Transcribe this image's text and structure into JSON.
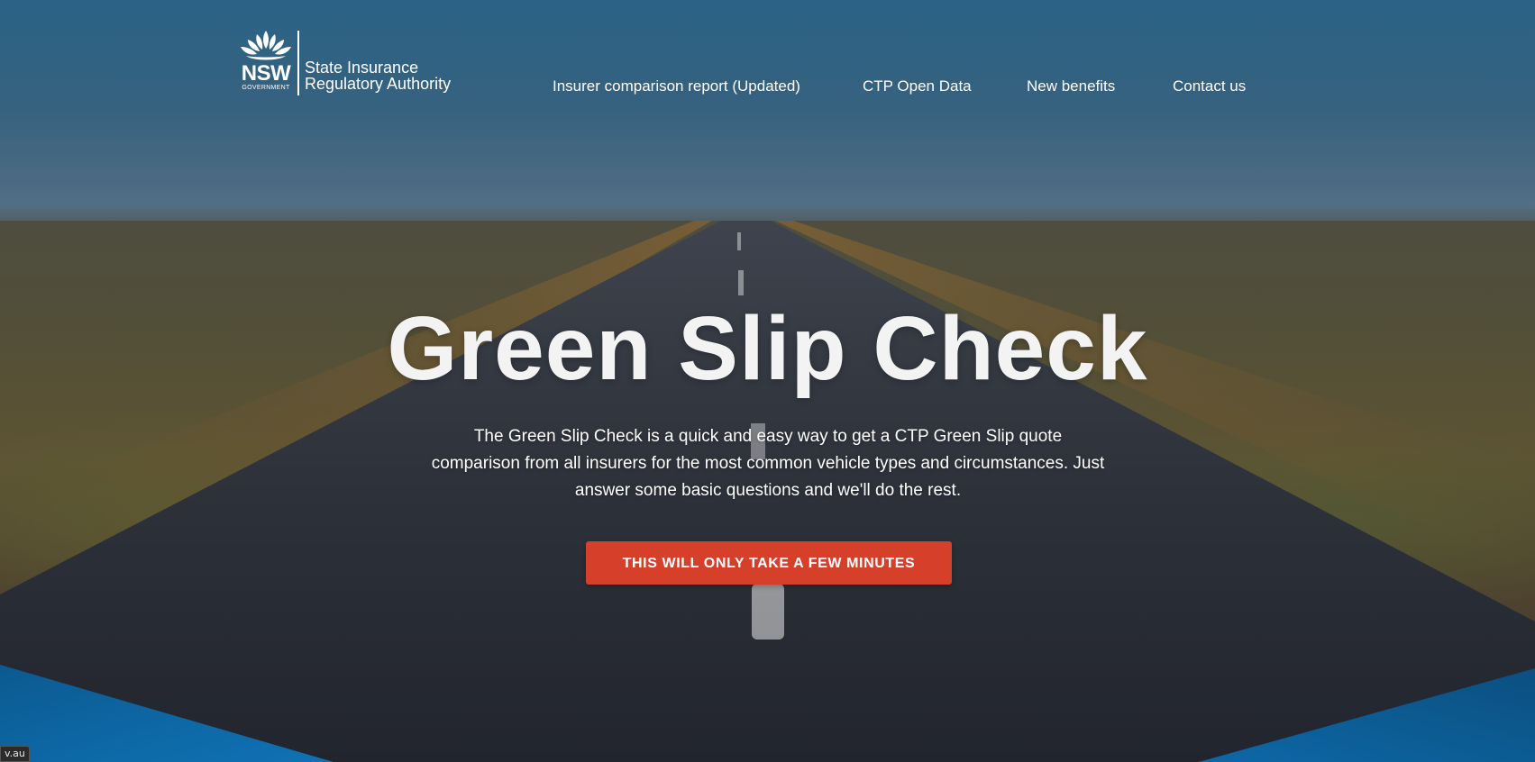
{
  "header": {
    "logo": {
      "mark_text": "NSW",
      "mark_subtext": "GOVERNMENT",
      "agency_line1": "State Insurance",
      "agency_line2": "Regulatory Authority"
    },
    "nav": [
      {
        "label": "Insurer comparison report (Updated)"
      },
      {
        "label": "CTP Open Data"
      },
      {
        "label": "New benefits"
      },
      {
        "label": "Contact us"
      }
    ]
  },
  "hero": {
    "title": "Green Slip Check",
    "description": "The Green Slip Check is a quick and easy way to get a CTP Green Slip quote comparison from all insurers for the most common vehicle types and circumstances. Just answer some basic questions and we'll do the rest.",
    "cta_label": "THIS WILL ONLY TAKE A FEW MINUTES"
  },
  "status_bar": {
    "url_fragment": "v.au"
  },
  "colors": {
    "cta": "#d6402a",
    "wedge_blue": "#0a5f99",
    "text": "#ffffff"
  }
}
